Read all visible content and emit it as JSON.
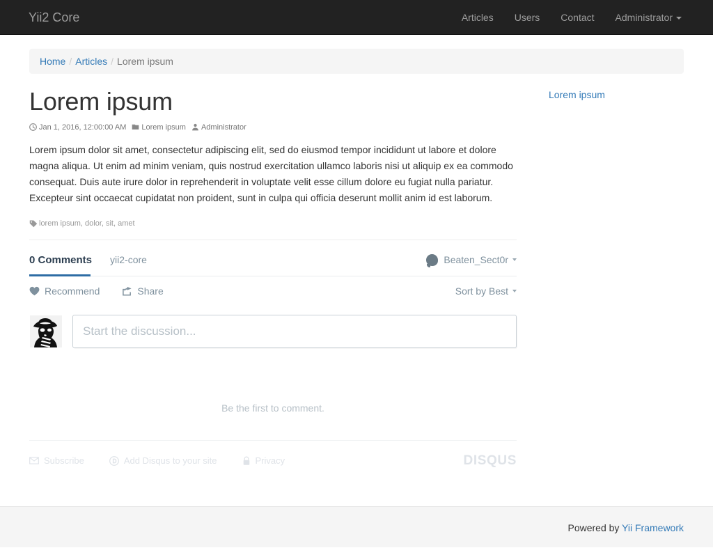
{
  "navbar": {
    "brand": "Yii2 Core",
    "items": [
      {
        "label": "Articles",
        "name": "nav-articles"
      },
      {
        "label": "Users",
        "name": "nav-users"
      },
      {
        "label": "Contact",
        "name": "nav-contact"
      },
      {
        "label": "Administrator",
        "name": "nav-administrator",
        "dropdown": true
      }
    ],
    "background": "#222222",
    "link_color": "#9d9d9d"
  },
  "breadcrumb": {
    "items": [
      {
        "label": "Home",
        "link": true
      },
      {
        "label": "Articles",
        "link": true
      },
      {
        "label": "Lorem ipsum",
        "link": false
      }
    ],
    "separator": "/"
  },
  "article": {
    "title": "Lorem ipsum",
    "meta": {
      "date": "Jan 1, 2016, 12:00:00 AM",
      "category": "Lorem ipsum",
      "author": "Administrator",
      "clock_icon": "clock-icon",
      "folder_icon": "folder-icon",
      "user_icon": "user-icon"
    },
    "body": "Lorem ipsum dolor sit amet, consectetur adipiscing elit, sed do eiusmod tempor incididunt ut labore et dolore magna aliqua. Ut enim ad minim veniam, quis nostrud exercitation ullamco laboris nisi ut aliquip ex ea commodo consequat. Duis aute irure dolor in reprehenderit in voluptate velit esse cillum dolore eu fugiat nulla pariatur. Excepteur sint occaecat cupidatat non proident, sunt in culpa qui officia deserunt mollit anim id est laborum.",
    "tags": {
      "icon": "tag-icon",
      "text": "lorem ipsum, dolor, sit, amet"
    }
  },
  "sidebar": {
    "links": [
      {
        "label": "Lorem ipsum"
      }
    ]
  },
  "disqus": {
    "comment_count_label": "0 Comments",
    "forum_name": "yii2-core",
    "username": "Beaten_Sect0r",
    "user_caret": "chevron-down-icon",
    "recommend_label": "Recommend",
    "recommend_icon": "heart-icon",
    "share_label": "Share",
    "share_icon": "share-icon",
    "sort_label": "Sort by Best",
    "sort_caret": "chevron-down-icon",
    "compose_placeholder": "Start the discussion...",
    "empty_state": "Be the first to comment.",
    "footer_links": [
      {
        "label": "Subscribe",
        "icon": "envelope-icon"
      },
      {
        "label": "Add Disqus to your site",
        "icon": "disqus-d-icon"
      },
      {
        "label": "Privacy",
        "icon": "lock-icon"
      }
    ],
    "logo": "DISQUS",
    "accent_underline_color": "#2e6da4",
    "muted_color": "#7f919e"
  },
  "footer": {
    "prefix": "Powered by ",
    "link_label": "Yii Framework",
    "background": "#f5f5f5",
    "link_color": "#337ab7"
  }
}
